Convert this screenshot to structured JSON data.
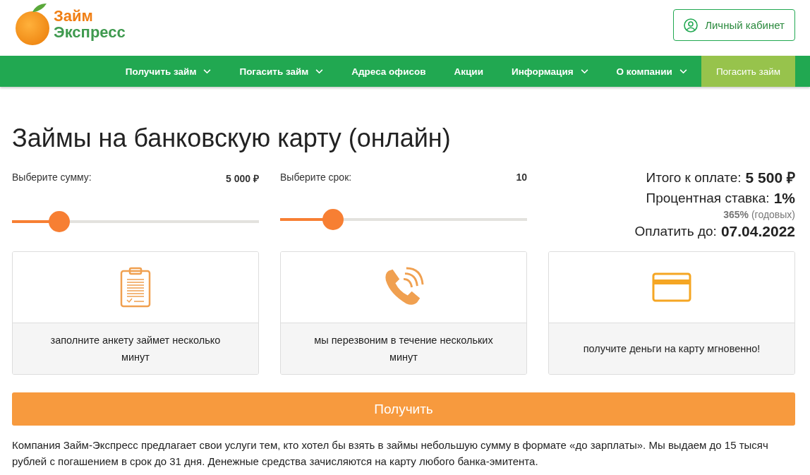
{
  "logo": {
    "line1": "Займ",
    "line2": "Экспресс"
  },
  "account_button": {
    "label": "Личный кабинет"
  },
  "nav": [
    {
      "label": "Получить займ",
      "dropdown": true,
      "highlighted": false
    },
    {
      "label": "Погасить займ",
      "dropdown": true,
      "highlighted": false
    },
    {
      "label": "Адреса офисов",
      "dropdown": false,
      "highlighted": false
    },
    {
      "label": "Акции",
      "dropdown": false,
      "highlighted": false
    },
    {
      "label": "Информация",
      "dropdown": true,
      "highlighted": false
    },
    {
      "label": "О компании",
      "dropdown": true,
      "highlighted": false
    },
    {
      "label": "Погасить займ",
      "dropdown": false,
      "highlighted": true
    }
  ],
  "title": "Займы на банковскую карту (онлайн)",
  "sliders": [
    {
      "label": "Выберите сумму:",
      "reading": "5 000 ₽",
      "level": 0.19
    },
    {
      "label": "Выберите срок:",
      "reading": "10",
      "level": 0.215
    }
  ],
  "summary": {
    "total_label": "Итого к оплате:",
    "total": "5 500 ₽",
    "rate_label": "Процентная ставка:",
    "rate": "1%",
    "annual": "**365%** (годовых)",
    "due_label": "Оплатить до:",
    "due": "07.04.2022"
  },
  "steps": [
    {
      "kind": "clipboard",
      "text": "заполните анкету займет несколько минут"
    },
    {
      "kind": "phone",
      "text": "мы перезвоним в течение нескольких минут"
    },
    {
      "kind": "card",
      "text": "получите деньги на карту мгновенно!"
    }
  ],
  "submit_button": "Получить",
  "description": "Компания Займ-Экспресс предлагает свои услуги тем, кто хотел бы взять в займы небольшую сумму в формате «до зарплаты». Мы выдаем до 15 тысяч рублей с погашением в срок до 31 дня. Денежные средства зачисляются на карту любого банка-эмитента."
}
